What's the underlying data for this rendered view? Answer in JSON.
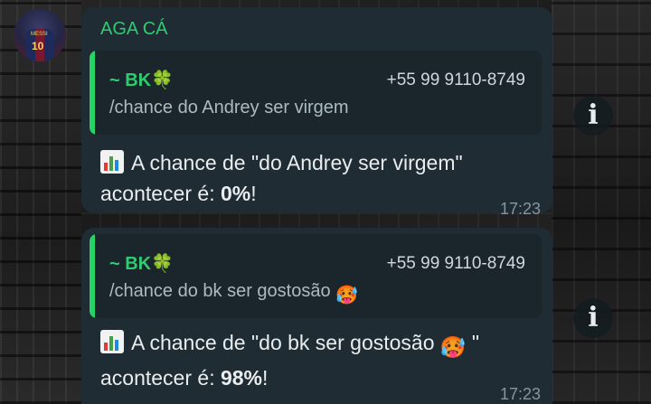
{
  "chat": {
    "group_name": "AGA CÁ",
    "messages": [
      {
        "quote": {
          "author": "~ BK",
          "author_emoji": "🍀",
          "phone": "+55 99 9110-8749",
          "text": "/chance do Andrey ser virgem",
          "text_emoji": ""
        },
        "body_prefix": "A chance de \"do Andrey ser virgem\"",
        "body_emoji": "",
        "body_after_emoji": "",
        "body_line2": "acontecer é: ",
        "percent": "0%",
        "body_end": "!",
        "time": "17:23"
      },
      {
        "quote": {
          "author": "~ BK",
          "author_emoji": "🍀",
          "phone": "+55 99 9110-8749",
          "text": "/chance do bk ser gostosão",
          "text_emoji": "🥵"
        },
        "body_prefix": "A chance de \"do bk ser gostosão",
        "body_emoji": "🥵",
        "body_after_emoji": " \"",
        "body_line2": "acontecer é: ",
        "percent": "98%",
        "body_end": "!",
        "time": "17:23"
      }
    ]
  },
  "icons": {
    "chart": "bar-chart-icon",
    "info": "info-icon",
    "avatar": "messi-jersey-avatar"
  },
  "colors": {
    "bubble": "#1f2c34",
    "quote_bar": "#25d366",
    "sender_green": "#2ecc71",
    "timestamp": "#8696a0"
  }
}
